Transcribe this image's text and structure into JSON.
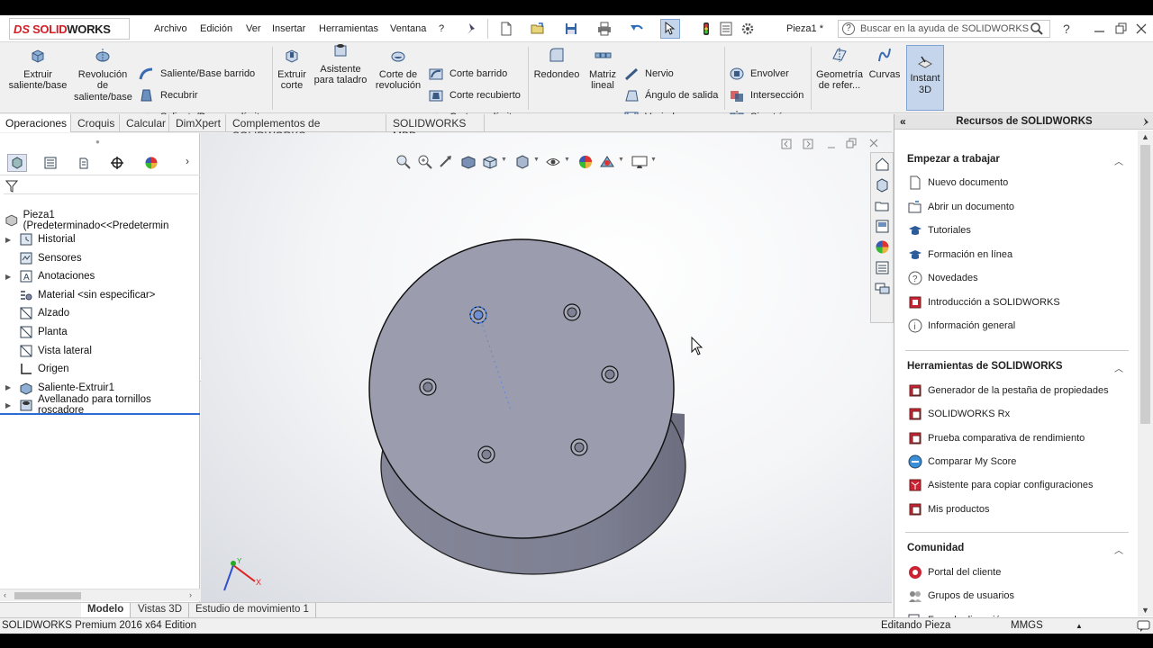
{
  "menubar": {
    "brand_prefix": "DS",
    "brand_a": "SOLID",
    "brand_b": "WORKS",
    "menus": [
      "Archivo",
      "Edición",
      "Ver",
      "Insertar",
      "Herramientas",
      "Ventana"
    ],
    "help_glyph": "?",
    "document_title": "Pieza1 *",
    "search_placeholder": "Buscar en la ayuda de SOLIDWORKS"
  },
  "commands": {
    "extruir_saliente": "Extruir saliente/base",
    "revolucion_saliente": "Revolución de saliente/base",
    "saliente_barrido": "Saliente/Base barrido",
    "recubrir": "Recubrir",
    "saliente_limite": "Saliente/Base por límite",
    "extruir_corte": "Extruir corte",
    "asistente_taladro": "Asistente para taladro",
    "corte_revolucion": "Corte de revolución",
    "corte_barrido": "Corte barrido",
    "corte_recubierto": "Corte recubierto",
    "corte_limite": "Corte por límite",
    "redondeo": "Redondeo",
    "matriz_lineal": "Matriz lineal",
    "nervio": "Nervio",
    "angulo_salida": "Ángulo de salida",
    "vaciado": "Vaciado",
    "envolver": "Envolver",
    "interseccion": "Intersección",
    "simetria": "Simetría",
    "geometria_referencia": "Geometría de refer...",
    "curvas": "Curvas",
    "instant3d": "Instant 3D"
  },
  "tabs": [
    "Operaciones",
    "Croquis",
    "Calcular",
    "DimXpert",
    "Complementos de SOLIDWORKS",
    "SOLIDWORKS MBD"
  ],
  "feature_tree": {
    "root": "Pieza1  (Predeterminado<<Predetermin",
    "items": [
      {
        "label": "Historial",
        "icon": "history-icon",
        "expandable": true
      },
      {
        "label": "Sensores",
        "icon": "sensor-icon",
        "expandable": false
      },
      {
        "label": "Anotaciones",
        "icon": "annotation-icon",
        "expandable": true
      },
      {
        "label": "Material <sin especificar>",
        "icon": "material-icon",
        "expandable": false
      },
      {
        "label": "Alzado",
        "icon": "plane-icon",
        "expandable": false
      },
      {
        "label": "Planta",
        "icon": "plane-icon",
        "expandable": false
      },
      {
        "label": "Vista lateral",
        "icon": "plane-icon",
        "expandable": false
      },
      {
        "label": "Origen",
        "icon": "origin-icon",
        "expandable": false
      },
      {
        "label": "Saliente-Extruir1",
        "icon": "extrude-icon",
        "expandable": true
      },
      {
        "label": "Avellanado para tornillos roscadore",
        "icon": "hole-wizard-icon",
        "expandable": true,
        "selected": true
      }
    ]
  },
  "triad": {
    "x": "X",
    "y": "Y"
  },
  "bottom_tabs": [
    "Modelo",
    "Vistas 3D",
    "Estudio de movimiento 1"
  ],
  "status": {
    "edition": "SOLIDWORKS Premium 2016 x64 Edition",
    "mode": "Editando Pieza",
    "units": "MMGS"
  },
  "task_pane": {
    "title": "Recursos de SOLIDWORKS",
    "sections": [
      {
        "title": "Empezar a trabajar",
        "items": [
          "Nuevo documento",
          "Abrir un documento",
          "Tutoriales",
          "Formación en línea",
          "Novedades",
          "Introducción a SOLIDWORKS",
          "Información general"
        ]
      },
      {
        "title": "Herramientas de SOLIDWORKS",
        "items": [
          "Generador de la pestaña de propiedades",
          "SOLIDWORKS Rx",
          "Prueba comparativa de rendimiento",
          "Comparar My Score",
          "Asistente para copiar configuraciones",
          "Mis productos"
        ]
      },
      {
        "title": "Comunidad",
        "items": [
          "Portal del cliente",
          "Grupos de usuarios",
          "Foro de discusión"
        ]
      }
    ]
  },
  "colors": {
    "accent": "#2b6cd4",
    "brand": "#d21f26",
    "part_top": "#9a9cad",
    "part_side": "#7b7d90"
  }
}
